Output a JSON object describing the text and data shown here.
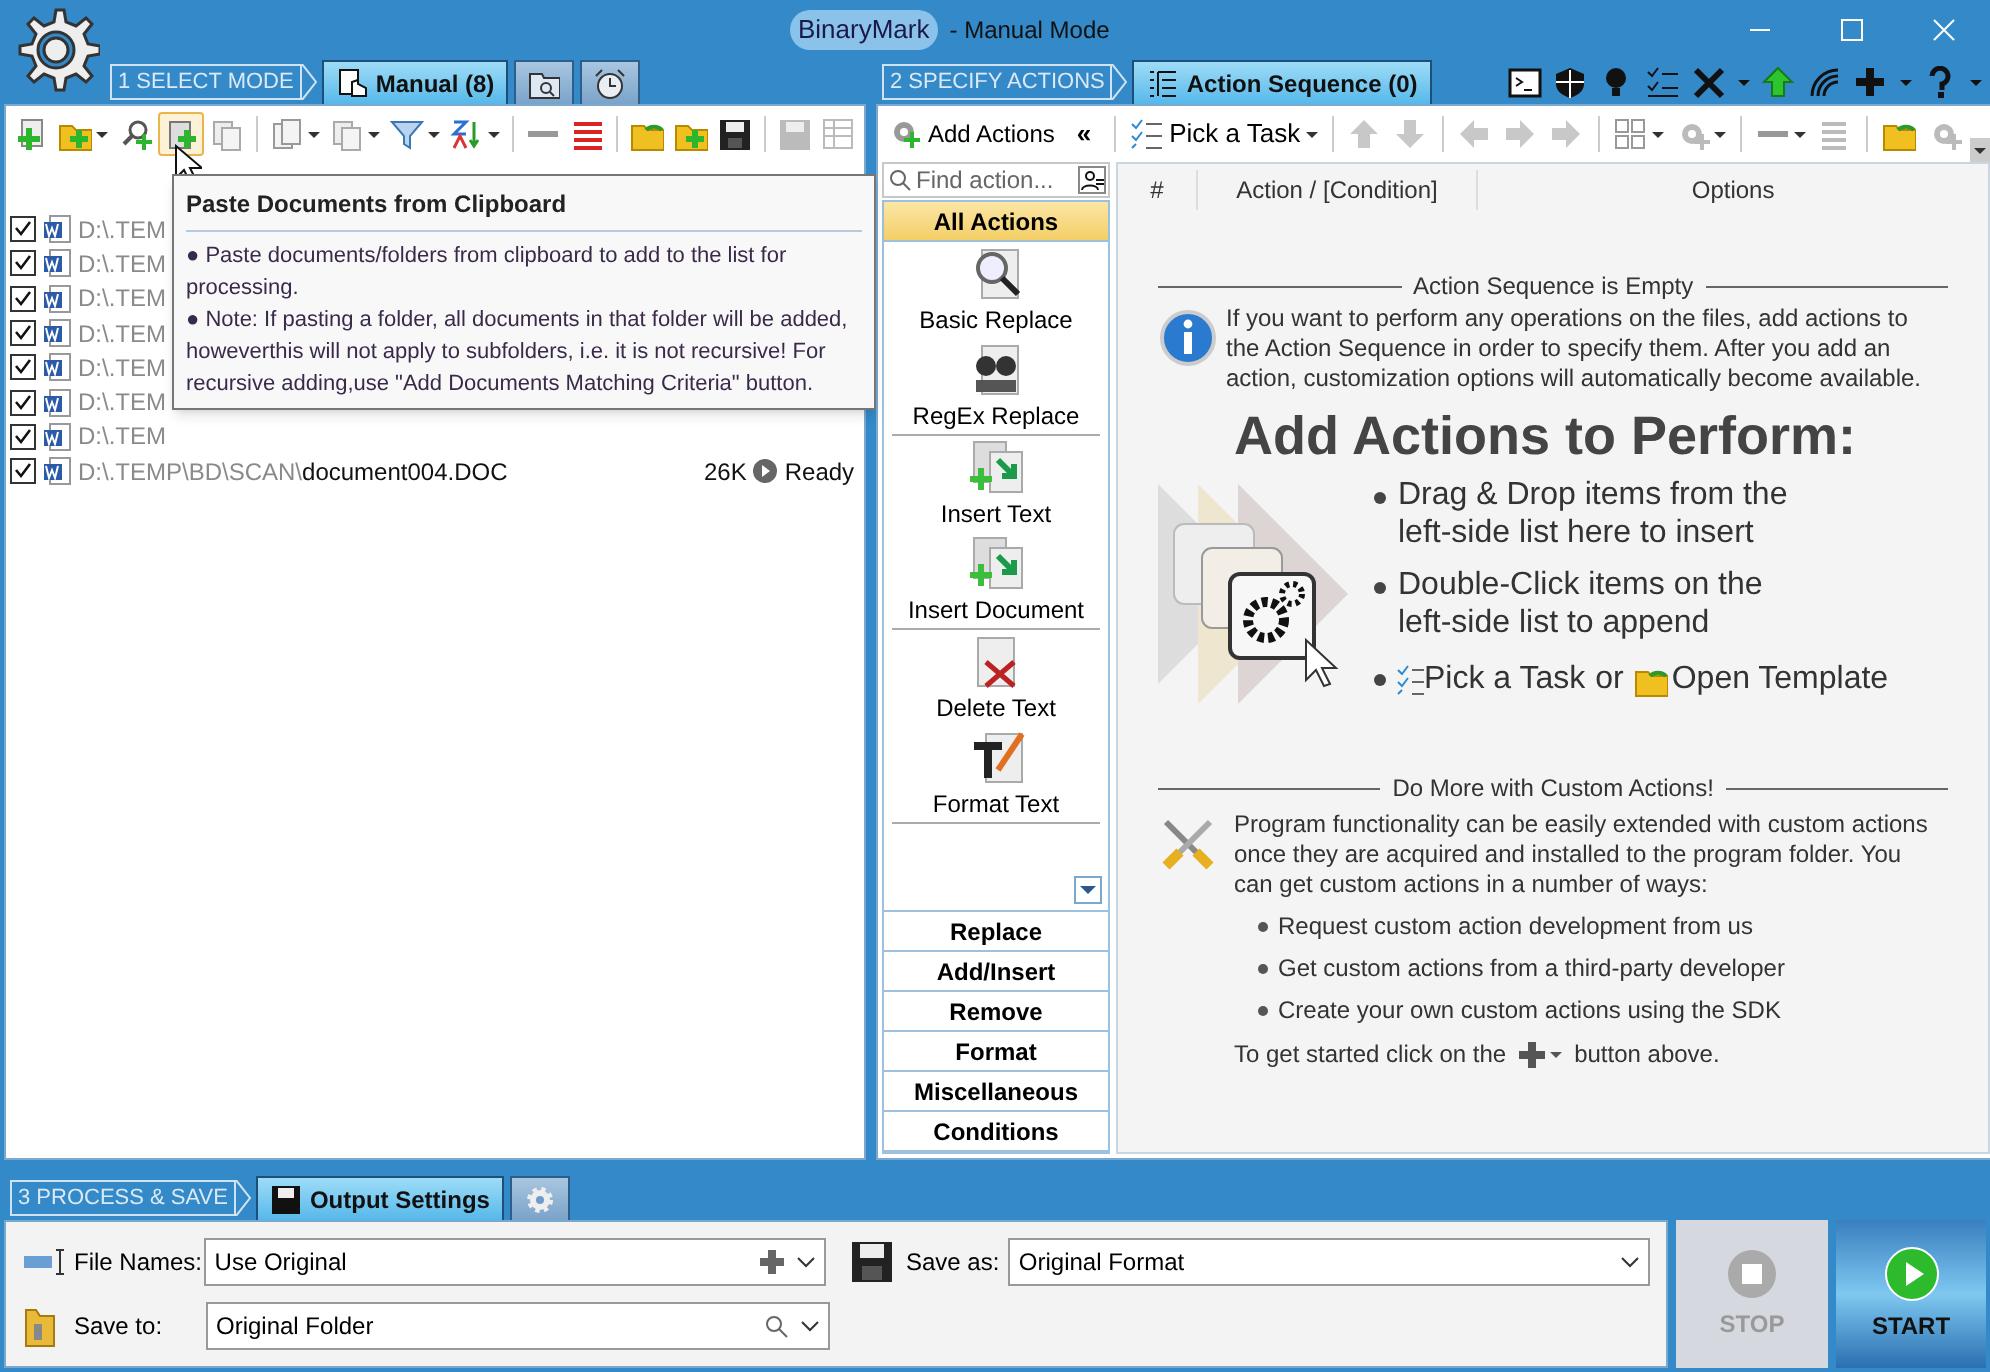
{
  "window": {
    "logo": "BinaryMark",
    "title": "- Manual Mode"
  },
  "select_mode": {
    "step": "1 SELECT MODE",
    "tabs": [
      {
        "kind": "manual",
        "label": "Manual (8)",
        "selected": true
      },
      {
        "kind": "folder-search",
        "selected": false
      },
      {
        "kind": "clock",
        "selected": false
      }
    ]
  },
  "specify_actions": {
    "step": "2 SPECIFY ACTIONS",
    "tabs": [
      {
        "kind": "sequence",
        "label": "Action Sequence (0)",
        "selected": true
      }
    ]
  },
  "file_list": {
    "rows": [
      {
        "checked": true,
        "path": "D:\\.TEM"
      },
      {
        "checked": true,
        "path": "D:\\.TEM"
      },
      {
        "checked": true,
        "path": "D:\\.TEM"
      },
      {
        "checked": true,
        "path": "D:\\.TEM"
      },
      {
        "checked": true,
        "path": "D:\\.TEM"
      },
      {
        "checked": true,
        "path": "D:\\.TEM"
      },
      {
        "checked": true,
        "path": "D:\\.TEM"
      },
      {
        "checked": true,
        "path": "D:\\.TEMP\\BD\\SCAN\\",
        "name": "document004.DOC",
        "size": "26K",
        "status": "Ready"
      }
    ]
  },
  "tooltip": {
    "title": "Paste Documents from Clipboard",
    "paragraphs": [
      "● Paste documents/folders from clipboard to add to the list for processing.",
      "● Note: If pasting a folder, all documents in that folder will be added, howeverthis will not apply to subfolders, i.e. it is not recursive! For recursive adding,use \"Add Documents Matching Criteria\" button."
    ]
  },
  "actions_toolbar": {
    "add_actions": "Add Actions",
    "collapse": "«",
    "pick_task": "Pick a Task"
  },
  "action_search": {
    "placeholder": "Find action..."
  },
  "action_categories": [
    {
      "label": "All Actions",
      "expanded": true,
      "items": [
        {
          "kind": "search",
          "label": "Basic Replace"
        },
        {
          "kind": "regex",
          "label": "RegEx Replace"
        },
        {
          "kind": "insert",
          "label": "Insert Text"
        },
        {
          "kind": "insert",
          "label": "Insert Document"
        },
        {
          "kind": "delete",
          "label": "Delete Text"
        },
        {
          "kind": "format",
          "label": "Format Text"
        }
      ]
    },
    {
      "label": "Replace",
      "expanded": false
    },
    {
      "label": "Add/Insert",
      "expanded": false
    },
    {
      "label": "Remove",
      "expanded": false
    },
    {
      "label": "Format",
      "expanded": false
    },
    {
      "label": "Miscellaneous",
      "expanded": false
    },
    {
      "label": "Conditions",
      "expanded": false
    }
  ],
  "sequence": {
    "columns": [
      "#",
      "Action / [Condition]",
      "Options"
    ],
    "empty_heading": "Action Sequence is Empty",
    "info": "If you want to perform any operations on the files, add actions to the Action Sequence in order to specify them. After you add an action, customization options will automatically become available.",
    "big_title": "Add Actions to Perform:",
    "bullets": [
      "Drag & Drop items from the left-side list here to insert",
      "Double-Click items on the left-side list to append"
    ],
    "task_link": "Pick a Task",
    "or": "or",
    "template_link": "Open Template",
    "custom_heading": "Do More with Custom Actions!",
    "custom_text": "Program functionality can be easily extended with custom actions once they are acquired and installed to the program folder. You can get custom actions in a number of ways:",
    "custom_bullets": [
      "Request custom action development from us",
      "Get custom actions from a third-party developer",
      "Create your own custom actions using the SDK"
    ],
    "footer_before": "To get started click on the",
    "footer_after": "button above."
  },
  "process_save": {
    "step": "3 PROCESS & SAVE",
    "tabs": [
      {
        "kind": "output",
        "label": "Output Settings",
        "selected": true
      },
      {
        "kind": "gear",
        "selected": false
      }
    ]
  },
  "output": {
    "file_names_label": "File Names:",
    "file_names": "Use Original",
    "save_as_label": "Save as:",
    "save_as": "Original Format",
    "save_to_label": "Save to:",
    "save_to": "Original Folder"
  },
  "stop": {
    "label": "STOP",
    "disabled": true
  },
  "start": {
    "label": "START",
    "disabled": false
  }
}
